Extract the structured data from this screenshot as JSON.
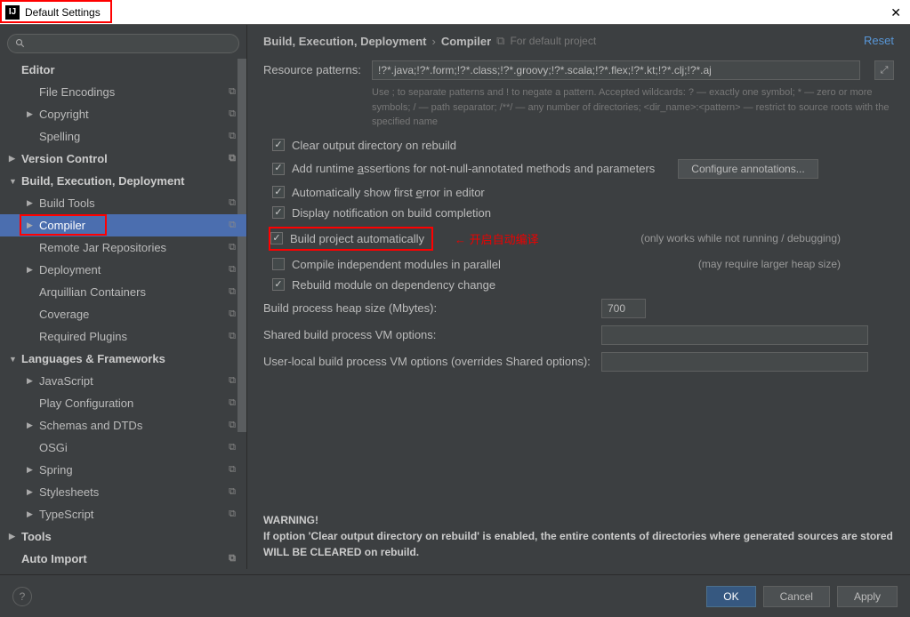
{
  "window": {
    "title": "Default Settings",
    "reset": "Reset"
  },
  "search": {
    "placeholder": ""
  },
  "sidebar": {
    "items": [
      {
        "label": "Editor",
        "bold": true,
        "arrow": "",
        "level": 0,
        "copy": false
      },
      {
        "label": "File Encodings",
        "bold": false,
        "arrow": "",
        "level": 1,
        "copy": true
      },
      {
        "label": "Copyright",
        "bold": false,
        "arrow": "▶",
        "level": 1,
        "copy": true
      },
      {
        "label": "Spelling",
        "bold": false,
        "arrow": "",
        "level": 1,
        "copy": true
      },
      {
        "label": "Version Control",
        "bold": true,
        "arrow": "▶",
        "level": 0,
        "copy": true
      },
      {
        "label": "Build, Execution, Deployment",
        "bold": true,
        "arrow": "▼",
        "level": 0,
        "copy": false
      },
      {
        "label": "Build Tools",
        "bold": false,
        "arrow": "▶",
        "level": 1,
        "copy": true
      },
      {
        "label": "Compiler",
        "bold": false,
        "arrow": "▶",
        "level": 1,
        "copy": true,
        "selected": true
      },
      {
        "label": "Remote Jar Repositories",
        "bold": false,
        "arrow": "",
        "level": 1,
        "copy": true
      },
      {
        "label": "Deployment",
        "bold": false,
        "arrow": "▶",
        "level": 1,
        "copy": true
      },
      {
        "label": "Arquillian Containers",
        "bold": false,
        "arrow": "",
        "level": 1,
        "copy": true
      },
      {
        "label": "Coverage",
        "bold": false,
        "arrow": "",
        "level": 1,
        "copy": true
      },
      {
        "label": "Required Plugins",
        "bold": false,
        "arrow": "",
        "level": 1,
        "copy": true
      },
      {
        "label": "Languages & Frameworks",
        "bold": true,
        "arrow": "▼",
        "level": 0,
        "copy": false
      },
      {
        "label": "JavaScript",
        "bold": false,
        "arrow": "▶",
        "level": 1,
        "copy": true
      },
      {
        "label": "Play Configuration",
        "bold": false,
        "arrow": "",
        "level": 1,
        "copy": true
      },
      {
        "label": "Schemas and DTDs",
        "bold": false,
        "arrow": "▶",
        "level": 1,
        "copy": true
      },
      {
        "label": "OSGi",
        "bold": false,
        "arrow": "",
        "level": 1,
        "copy": true
      },
      {
        "label": "Spring",
        "bold": false,
        "arrow": "▶",
        "level": 1,
        "copy": true
      },
      {
        "label": "Stylesheets",
        "bold": false,
        "arrow": "▶",
        "level": 1,
        "copy": true
      },
      {
        "label": "TypeScript",
        "bold": false,
        "arrow": "▶",
        "level": 1,
        "copy": true
      },
      {
        "label": "Tools",
        "bold": true,
        "arrow": "▶",
        "level": 0,
        "copy": false
      },
      {
        "label": "Auto Import",
        "bold": true,
        "arrow": "",
        "level": 0,
        "copy": true
      }
    ]
  },
  "breadcrumb": {
    "a": "Build, Execution, Deployment",
    "b": "Compiler",
    "hint": "For default project"
  },
  "form": {
    "resource_label": "Resource patterns:",
    "resource_value": "!?*.java;!?*.form;!?*.class;!?*.groovy;!?*.scala;!?*.flex;!?*.kt;!?*.clj;!?*.aj",
    "help": "Use ; to separate patterns and ! to negate a pattern. Accepted wildcards: ? — exactly one symbol; * — zero or more symbols; / — path separator; /**/ — any number of directories; <dir_name>:<pattern> — restrict to source roots with the specified name"
  },
  "checks": {
    "c1": "Clear output directory on rebuild",
    "c2a": "Add runtime ",
    "c2b": "a",
    "c2c": "ssertions for not-null-annotated methods and parameters",
    "c2btn": "Configure annotations...",
    "c3a": "Automatically show first ",
    "c3b": "e",
    "c3c": "rror in editor",
    "c4": "Display notification on build completion",
    "c5": "Build project automatically",
    "c5note": "(only works while not running / debugging)",
    "c5ann": "开启自动编译",
    "c6": "Compile independent modules in parallel",
    "c6note": "(may require larger heap size)",
    "c7": "Rebuild module on dependency change"
  },
  "fields": {
    "heap_label": "Build process heap size (Mbytes):",
    "heap_value": "700",
    "shared_label": "Shared build process VM options:",
    "shared_value": "",
    "user_label": "User-local build process VM options (overrides Shared options):",
    "user_value": ""
  },
  "warning": {
    "title": "WARNING!",
    "body": "If option 'Clear output directory on rebuild' is enabled, the entire contents of directories where generated sources are stored WILL BE CLEARED on rebuild."
  },
  "footer": {
    "ok": "OK",
    "cancel": "Cancel",
    "apply": "Apply"
  }
}
